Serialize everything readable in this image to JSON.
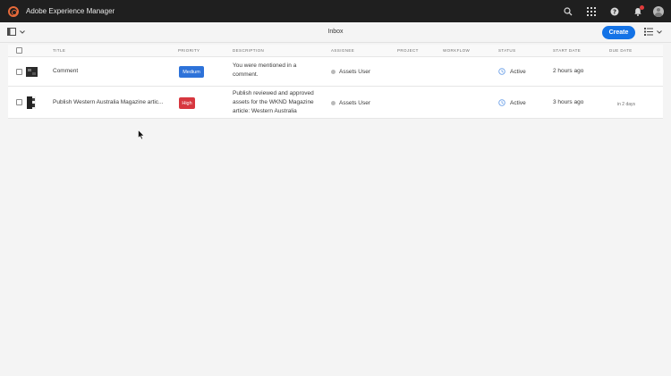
{
  "shell": {
    "app_title": "Adobe Experience Manager",
    "icons": [
      "search-icon",
      "apps-grid-icon",
      "help-icon",
      "notifications-bell-icon",
      "user-avatar"
    ],
    "accent": "#1473e6",
    "logo_color": "#e66a3a"
  },
  "actionbar": {
    "page_title": "Inbox",
    "create_label": "Create"
  },
  "table": {
    "columns": [
      "TITLE",
      "PRIORITY",
      "DESCRIPTION",
      "ASSIGNEE",
      "PROJECT",
      "WORKFLOW",
      "STATUS",
      "START DATE",
      "DUE DATE"
    ],
    "rows": [
      {
        "title": "Comment",
        "priority": "Medium",
        "priority_color": "#2d72d9",
        "description": [
          "You were mentioned in a",
          "comment."
        ],
        "assignee": "Assets User",
        "project": "",
        "workflow": "",
        "status": "Active",
        "start_date": "2 hours ago",
        "due_date": ""
      },
      {
        "title": "Publish Western Australia Magazine artic...",
        "priority": "High",
        "priority_color": "#d7373f",
        "description": [
          "Publish reviewed and approved",
          "assets for the WKND Magazine",
          "article: Western Australia"
        ],
        "assignee": "Assets User",
        "project": "",
        "workflow": "",
        "status": "Active",
        "start_date": "3 hours ago",
        "due_date": "in 2 days"
      }
    ]
  }
}
